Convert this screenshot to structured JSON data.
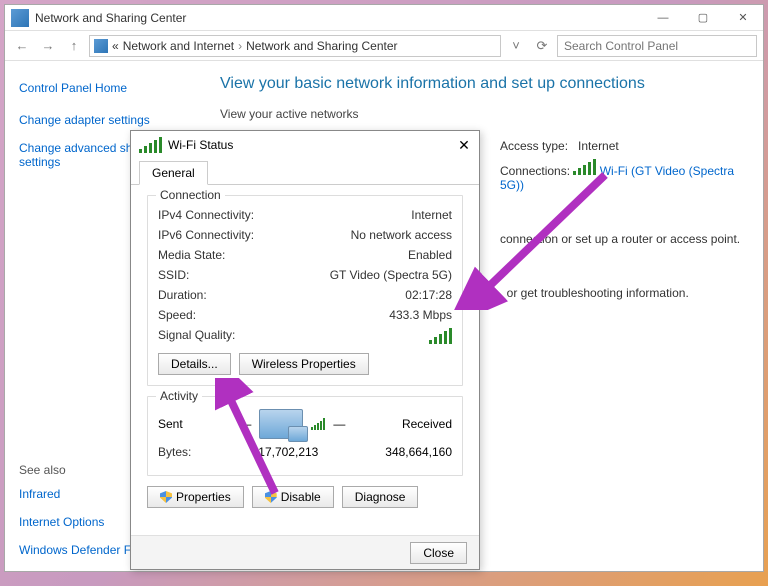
{
  "window": {
    "title": "Network and Sharing Center",
    "min": "—",
    "max": "▢",
    "close": "✕"
  },
  "toolbar": {
    "back": "←",
    "fwd": "→",
    "up": "↑",
    "bc1": "Network and Internet",
    "bc2": "Network and Sharing Center",
    "refresh": "⟳",
    "search_placeholder": "Search Control Panel"
  },
  "sidebar": {
    "home": "Control Panel Home",
    "link1": "Change adapter settings",
    "link2": "Change advanced sharing settings",
    "seealso": "See also",
    "link3": "Infrared",
    "link4": "Internet Options",
    "link5": "Windows Defender Firewall"
  },
  "content": {
    "heading": "View your basic network information and set up connections",
    "sub": "View your active networks",
    "access_lbl": "Access type:",
    "access_val": "Internet",
    "conn_lbl": "Connections:",
    "conn_val": "Wi-Fi (GT Video (Spectra 5G))",
    "frag1": "connection or set up a router or access point.",
    "frag2": ", or get troubleshooting information."
  },
  "dialog": {
    "title": "Wi-Fi Status",
    "close": "✕",
    "tab": "General",
    "group_conn": "Connection",
    "ipv4_k": "IPv4 Connectivity:",
    "ipv4_v": "Internet",
    "ipv6_k": "IPv6 Connectivity:",
    "ipv6_v": "No network access",
    "media_k": "Media State:",
    "media_v": "Enabled",
    "ssid_k": "SSID:",
    "ssid_v": "GT Video (Spectra 5G)",
    "dur_k": "Duration:",
    "dur_v": "02:17:28",
    "speed_k": "Speed:",
    "speed_v": "433.3 Mbps",
    "sig_k": "Signal Quality:",
    "btn_details": "Details...",
    "btn_wprops": "Wireless Properties",
    "group_act": "Activity",
    "sent": "Sent",
    "received": "Received",
    "bytes_lbl": "Bytes:",
    "bytes_sent": "17,702,213",
    "bytes_recv": "348,664,160",
    "btn_props": "Properties",
    "btn_disable": "Disable",
    "btn_diag": "Diagnose",
    "btn_close": "Close"
  }
}
